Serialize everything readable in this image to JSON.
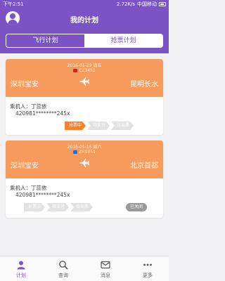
{
  "status_bar": {
    "time": "下午2:51",
    "network": "2.72K/s",
    "carrier": "中国移动"
  },
  "header": {
    "title": "我的计划"
  },
  "tabs": [
    {
      "label": "飞行计划"
    },
    {
      "label": "抢票计划"
    }
  ],
  "cards": [
    {
      "date": "2016-01-29 周五",
      "flight_no": "CZ3451",
      "from": "深圳宝安",
      "to": "昆明长水",
      "passenger": "乘机人：丁蕊依",
      "id_number": "420981********245x",
      "steps": [
        "抢票中",
        "待支付",
        "待出票"
      ]
    },
    {
      "date": "2016-01-16 周六",
      "flight_no": "ZH9851",
      "from": "深圳宝安",
      "to": "北京首都",
      "passenger": "乘机人：丁蕊依",
      "id_number": "420981********245x",
      "steps": [
        "抢票中",
        "待支付",
        "待出票"
      ],
      "status": "已关闭"
    }
  ],
  "bottom_nav": [
    {
      "label": "计划",
      "icon": "plan-icon"
    },
    {
      "label": "查询",
      "icon": "search-icon"
    },
    {
      "label": "消息",
      "icon": "message-icon"
    },
    {
      "label": "更多",
      "icon": "more-icon"
    }
  ],
  "colors": {
    "primary": "#7b53c4",
    "card_header": "#f79b5c",
    "active_step": "#f5812a"
  }
}
